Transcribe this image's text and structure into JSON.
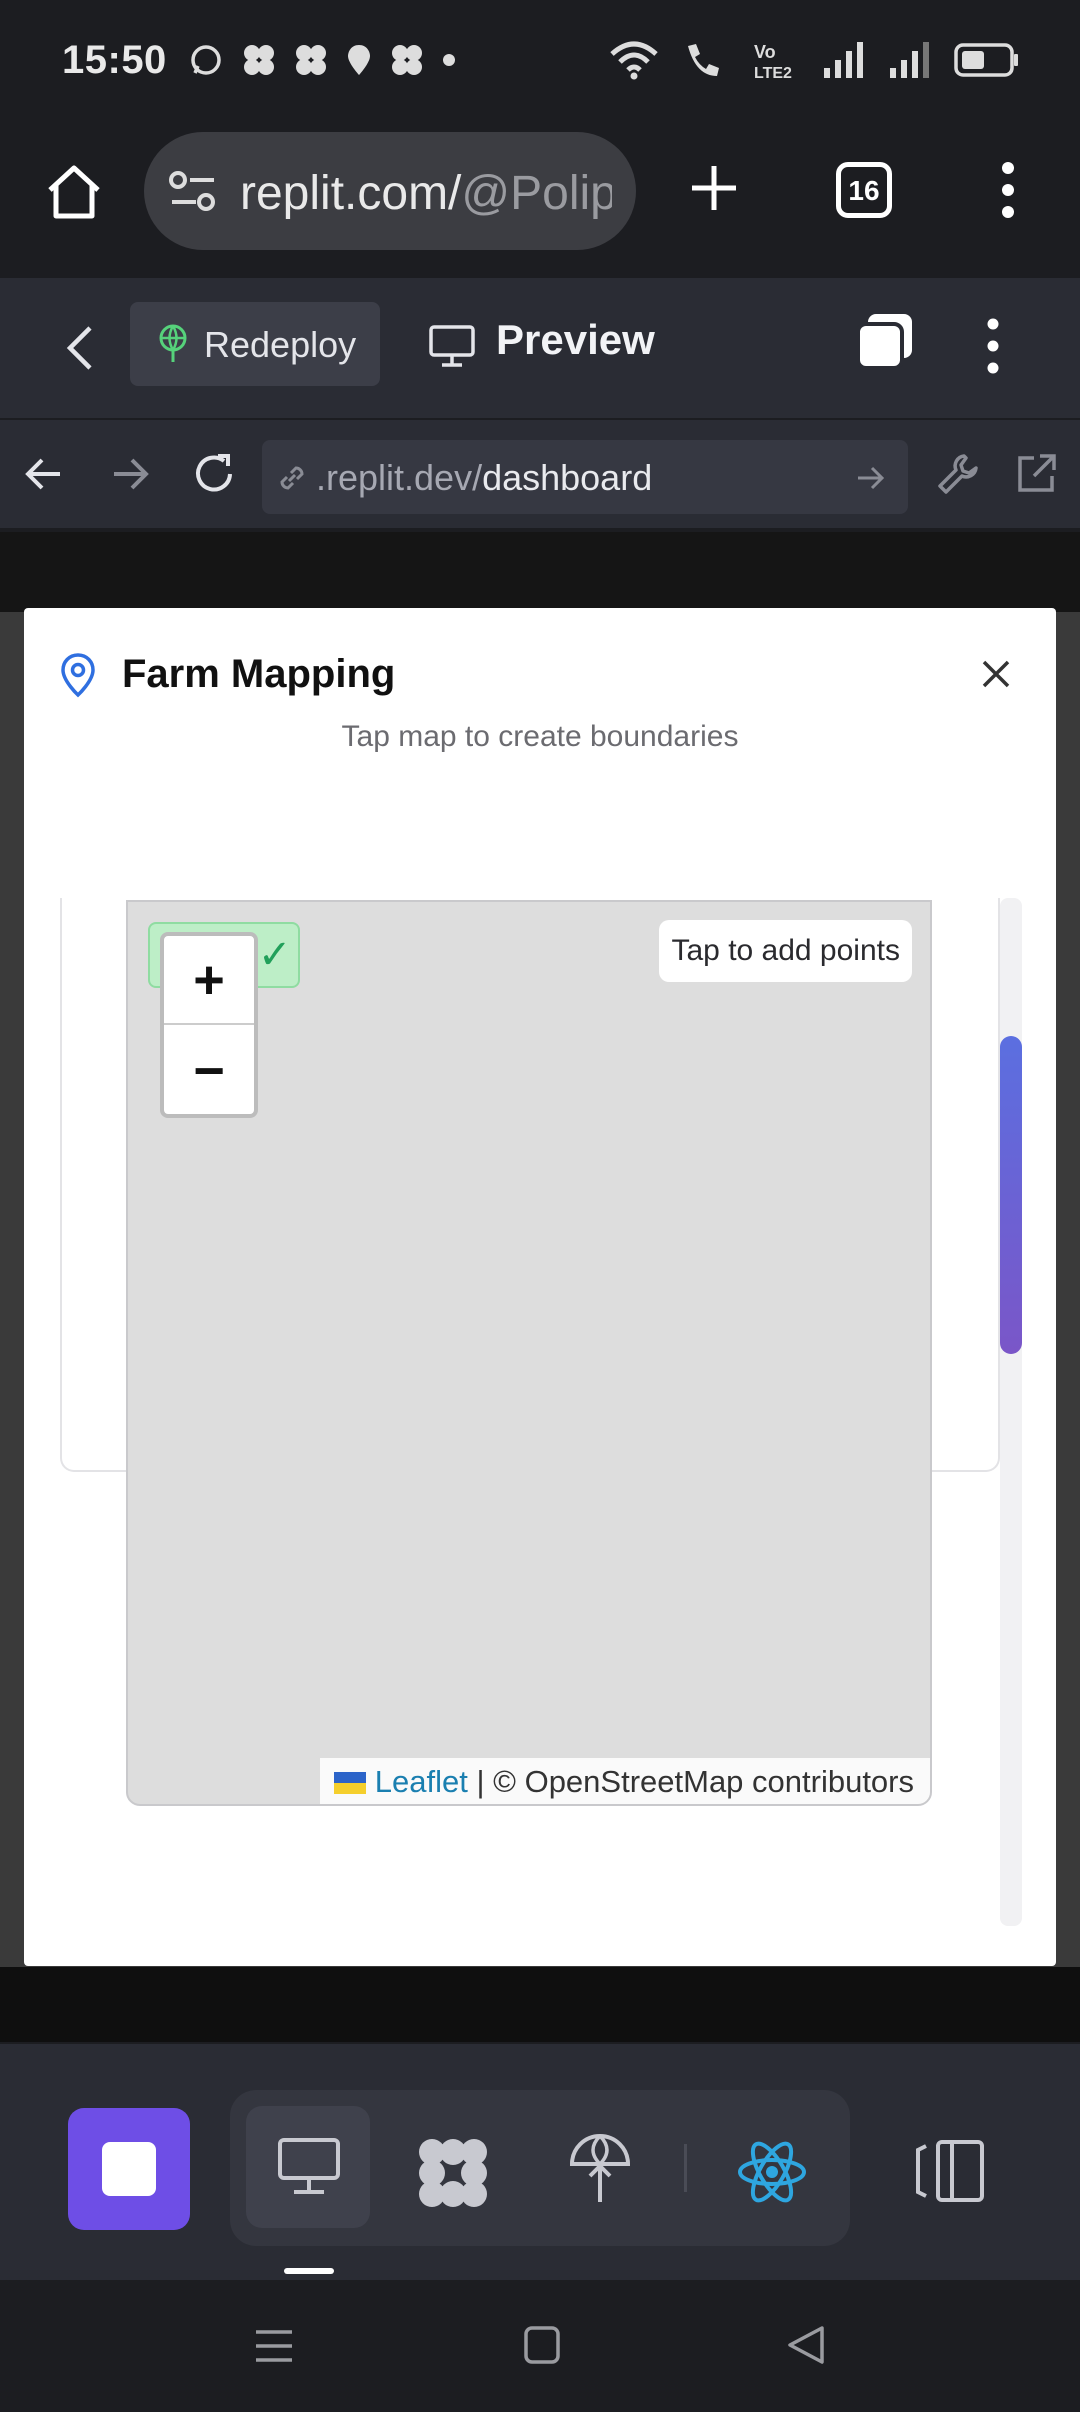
{
  "status_bar": {
    "time": "15:50"
  },
  "browser": {
    "url_host": "replit.com/",
    "url_path": "@Polip",
    "tab_count": "16"
  },
  "replit_header": {
    "redeploy_label": "Redeploy",
    "preview_label": "Preview"
  },
  "webview": {
    "url_prefix": ".replit.dev/",
    "url_path": "dashboard"
  },
  "modal": {
    "title": "Farm Mapping",
    "subtitle": "Tap map to create boundaries",
    "map": {
      "hint": "Tap to add points",
      "zoom_in": "+",
      "zoom_out": "−",
      "badge_check": "✓",
      "attribution_link": "Leaflet",
      "attribution_text": " | © OpenStreetMap contributors"
    }
  },
  "colors": {
    "accent": "#6e4ee6",
    "map_bg": "#dddddd",
    "scroll_gradient": [
      "#5b6fe0",
      "#7a56c8"
    ],
    "leaflet_link": "#1a7fb0"
  }
}
